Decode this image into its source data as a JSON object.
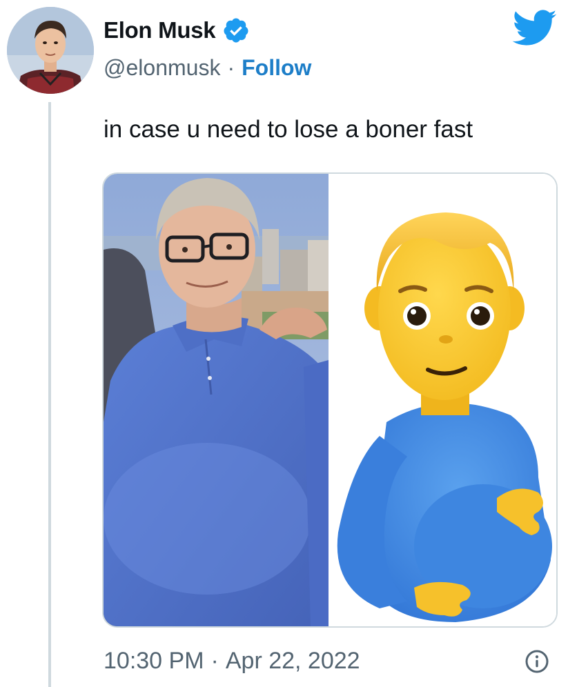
{
  "author": {
    "display_name": "Elon Musk",
    "handle": "@elonmusk",
    "separator": "·",
    "follow_label": "Follow",
    "verified": true
  },
  "tweet": {
    "text": "in case u need to lose a boner fast"
  },
  "media": {
    "left_image": "photo-man-in-blue-polo",
    "right_image": "pregnant-man-emoji"
  },
  "footer": {
    "time": "10:30 PM",
    "separator": "·",
    "date": "Apr 22, 2022"
  },
  "icons": {
    "brand": "twitter-bird-icon",
    "verified": "verified-badge-icon",
    "info": "info-icon"
  },
  "colors": {
    "brand_blue": "#1d9bf0",
    "link_blue": "#1d7ec8",
    "secondary_text": "#536471",
    "border": "#cfd9de"
  }
}
